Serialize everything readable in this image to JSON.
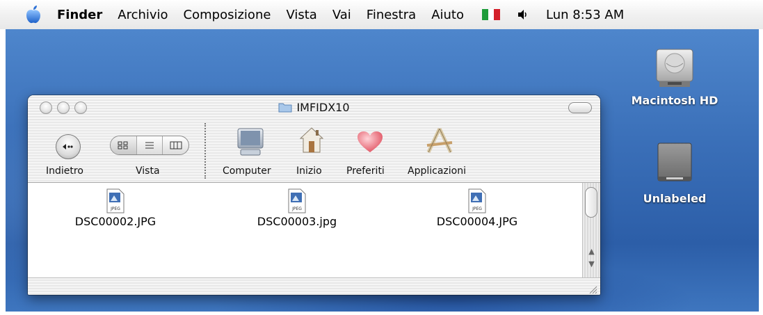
{
  "menubar": {
    "items": [
      "Finder",
      "Archivio",
      "Composizione",
      "Vista",
      "Vai",
      "Finestra",
      "Aiuto"
    ],
    "clock": "Lun 8:53 AM"
  },
  "desktop": {
    "icons": [
      {
        "label": "Macintosh HD",
        "icon": "hard-disk-icon"
      },
      {
        "label": "Unlabeled",
        "icon": "removable-disk-icon"
      }
    ]
  },
  "window": {
    "title": "IMFIDX10",
    "toolbar": {
      "back_label": "Indietro",
      "view_label": "Vista",
      "items": [
        {
          "label": "Computer",
          "icon": "computer-icon"
        },
        {
          "label": "Inizio",
          "icon": "home-icon"
        },
        {
          "label": "Preferiti",
          "icon": "heart-icon"
        },
        {
          "label": "Applicazioni",
          "icon": "applications-icon"
        }
      ]
    },
    "files": [
      {
        "name": "DSC00002.JPG",
        "badge": "JPEG"
      },
      {
        "name": "DSC00003.jpg",
        "badge": "JPEG"
      },
      {
        "name": "DSC00004.JPG",
        "badge": "JPEG"
      }
    ]
  },
  "colors": {
    "desktop": "#3a6fb8",
    "flag_green": "#1e9c3a",
    "flag_white": "#ffffff",
    "flag_red": "#d4202a"
  }
}
